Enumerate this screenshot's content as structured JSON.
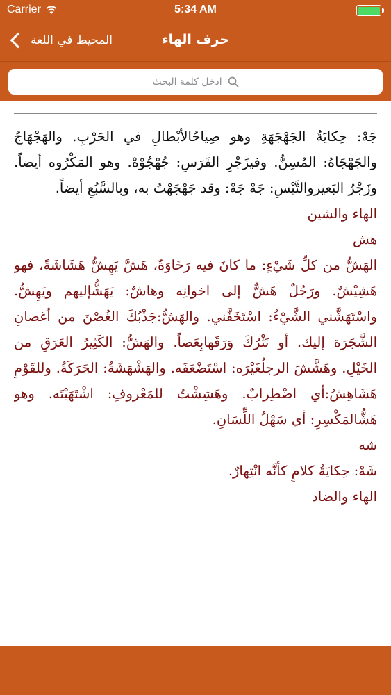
{
  "status_bar": {
    "carrier": "Carrier",
    "time": "5:34 AM"
  },
  "nav": {
    "back_label": "المحيط في اللغة",
    "title": "حرف الهاء"
  },
  "search": {
    "placeholder": "ادخل كلمة البحث"
  },
  "content": {
    "entry_black": "جَهْ: حِكايَةُ الجَهْجَهَةِ وهو صِياحُالأبْطالِ في الحَرْبِ. والهَجْهَاجُ والجَهْجَاهُ: المُسِنُّ. وفيزَجْرِ الفَرَسِ: جُهْجُوْهْ. وهو المَكْرُوه أيضاً. وزَجْرُ البَعيروالتَّيْسِ: جَهْ جَهْ: وقد جَهْجَهْتُ به، وبالسَّبُعِ أيضاً.",
    "section_1": "الهاء والشين",
    "root_1": "هش",
    "entry_1": "الهَشُّ من كلِّ شَيْءٍ: ما كانَ فيه رَخَاوَةٌ، هَشَّ يَهِشُّ هَشَاشَةً، فهو هَشِيْشٌ. ورَجُلٌ هَشٌّ إلى اخوانِه وهاشٌ: يَهَشُّإليهم ويَهِشُّ. واسْتَهَشَّني الشَّيْءُ: اسْتَخَفَّني. والهَشُّ:جَذْبُكَ الغُصْنَ من أغصانِ الشَّجَرَة إليك. أو نَثْرُكَ وَرَقَهابِعَصاً. والهَشُّ: الكَثِيرُ العَرَقِ من الخَيْلِ. وهَشَّشَ الرجلُغَيْرَه: اسْتَضْعَفَه. والهَشْهَشَةُ: الحَرَكَةُ. وللقَوْمِ هَشَاهِشُ:أي اضْطِرابٌ. وهَشِشْتُ للمَعْروفِ: اشْتَهَيْتَه. وهو هَشُّالمَكْسِرِ: أي سَهْلُ اللِّسَانِ.",
    "root_2": "شه",
    "entry_2": "شَهْ: حِكايَةُ كلامٍ كأنَّه انْتِهارٌ.",
    "section_2": "الهاء والضاد"
  },
  "colors": {
    "brand_orange": "#c95a1e",
    "text_black": "#111111",
    "text_maroon": "#7a1111",
    "battery_green": "#4cd964"
  }
}
